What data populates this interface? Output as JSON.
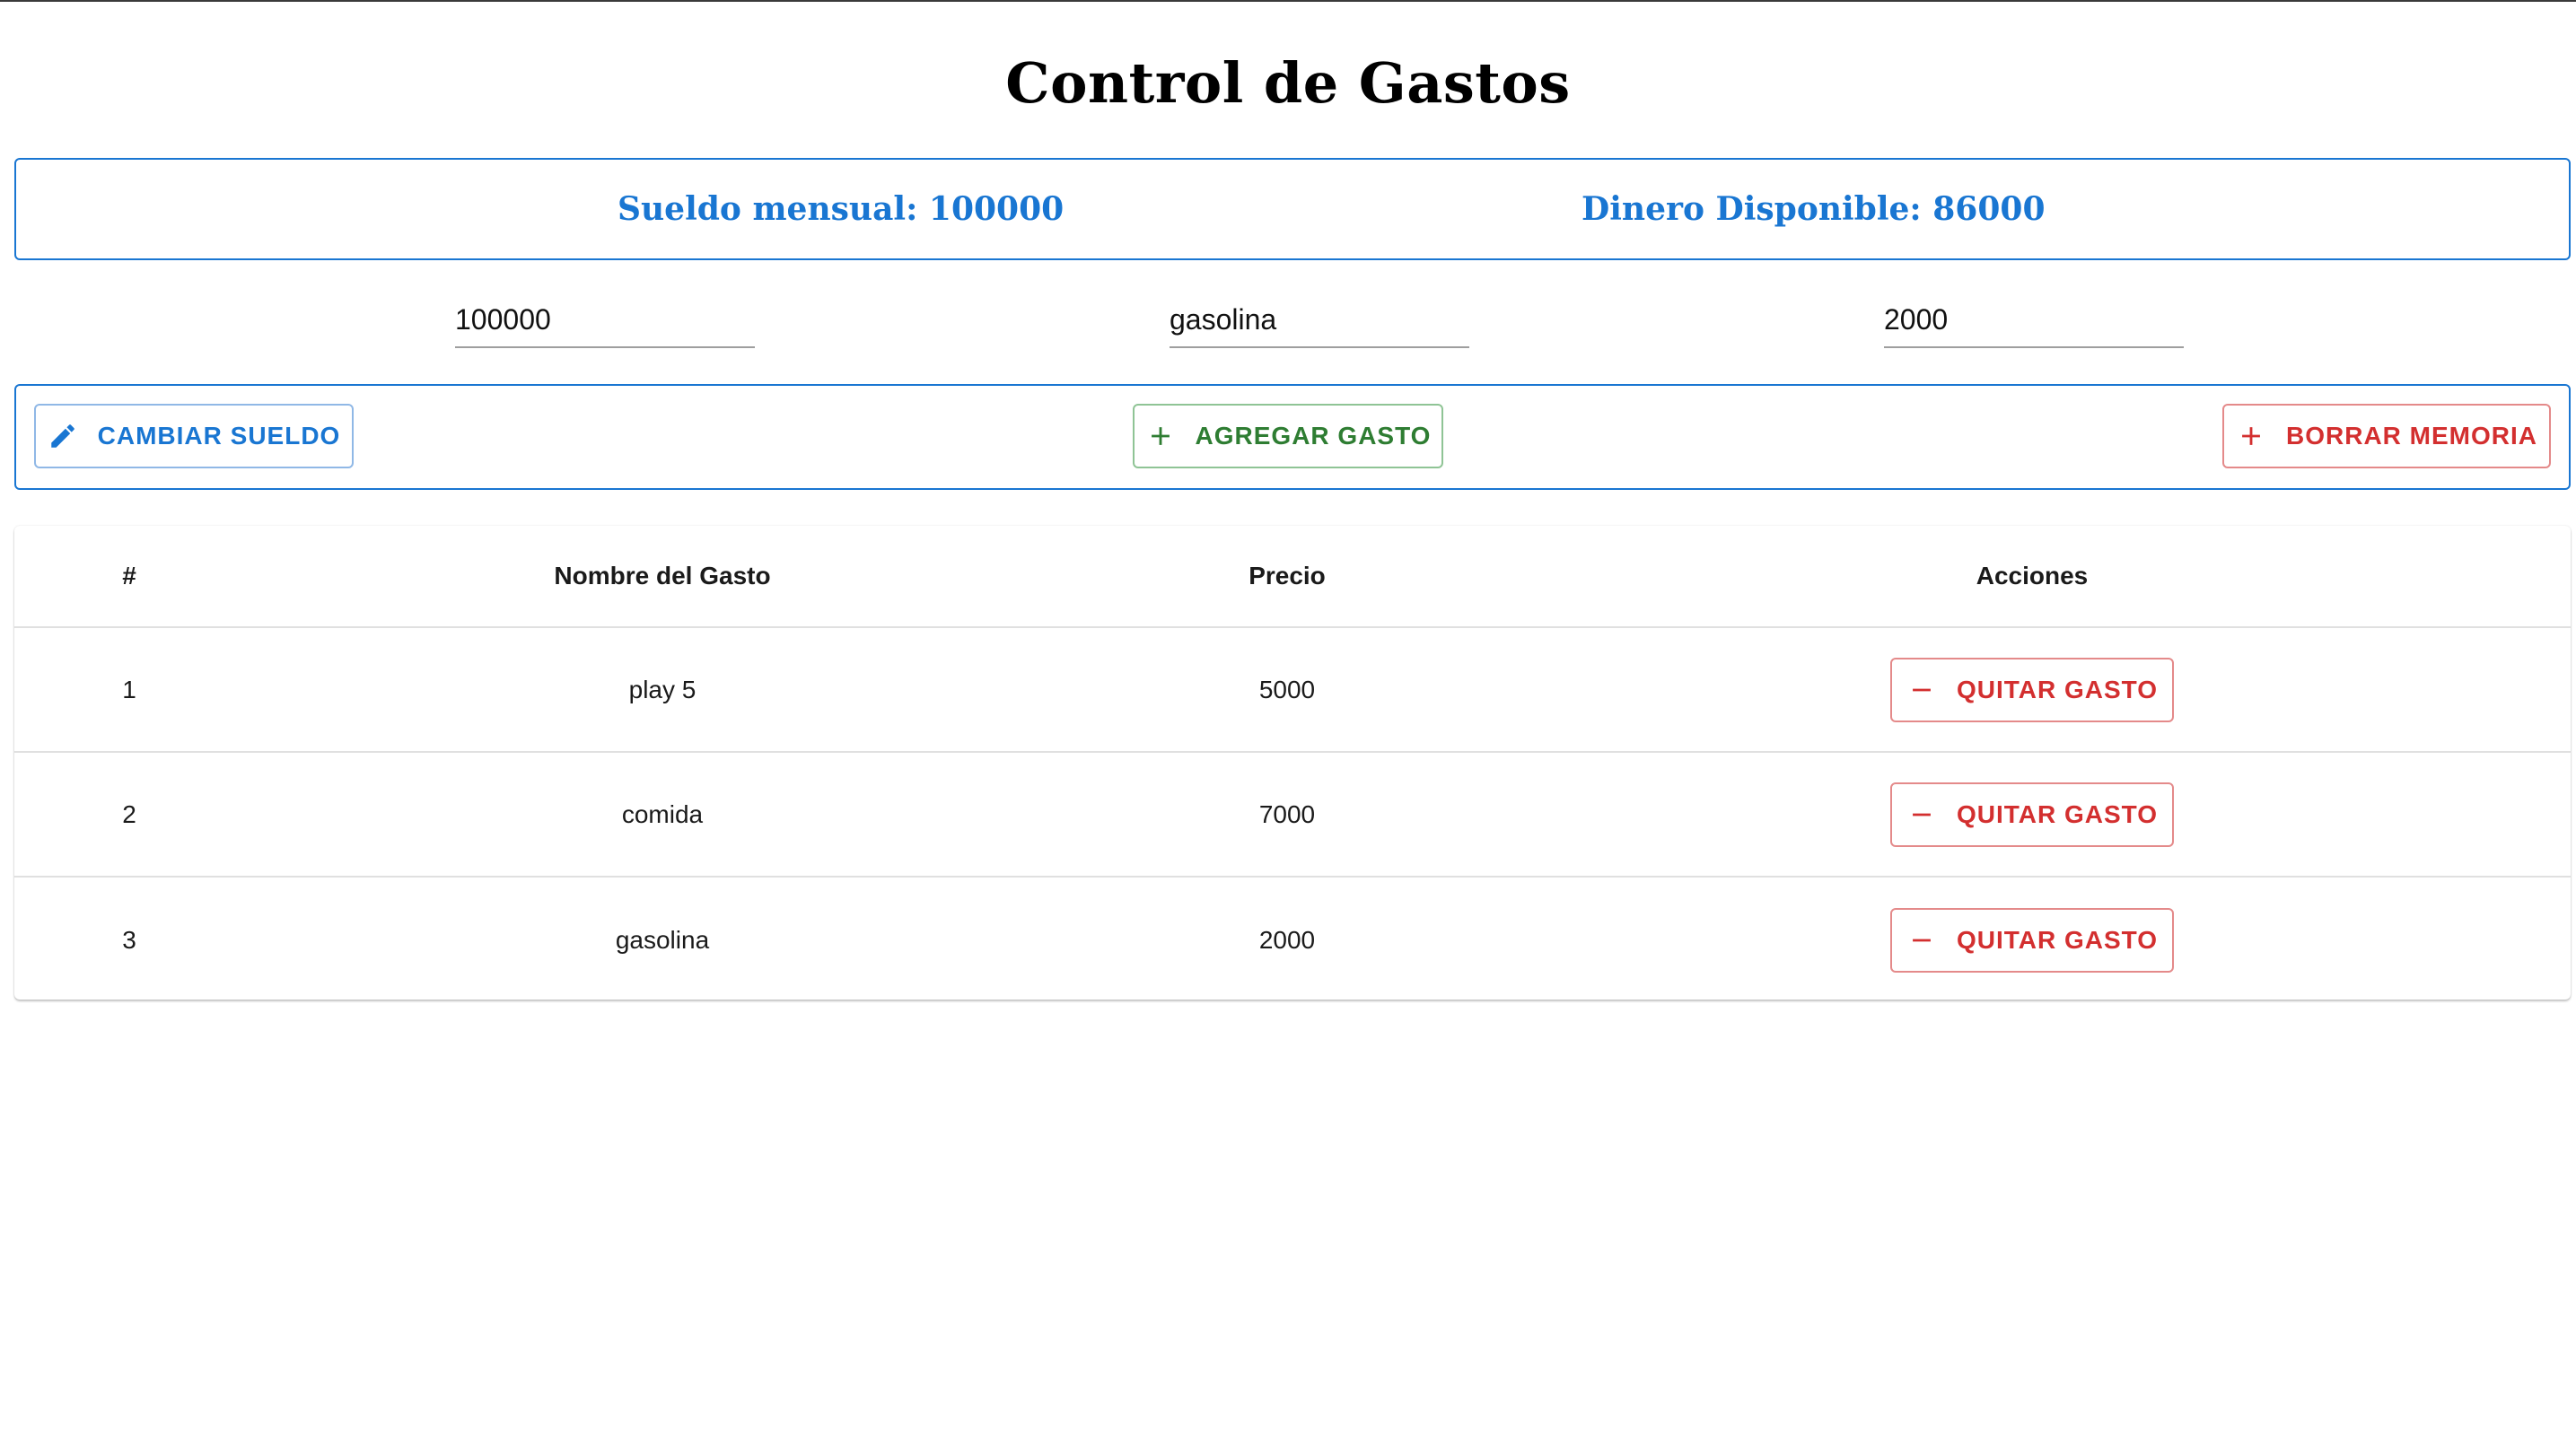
{
  "title": "Control de Gastos",
  "summary": {
    "sueldo_label": "Sueldo mensual: 100000",
    "disponible_label": "Dinero Disponible: 86000"
  },
  "inputs": {
    "sueldo_value": "100000",
    "nombre_value": "gasolina",
    "precio_value": "2000"
  },
  "actions": {
    "cambiar_label": "CAMBIAR SUELDO",
    "cambiar_icon": "pencil-icon",
    "agregar_label": "AGREGAR GASTO",
    "agregar_icon": "plus-icon",
    "borrar_label": "BORRAR MEMORIA",
    "borrar_icon": "plus-icon"
  },
  "table": {
    "headers": [
      "#",
      "Nombre del Gasto",
      "Precio",
      "Acciones"
    ],
    "rows": [
      {
        "num": "1",
        "nombre": "play 5",
        "precio": "5000",
        "action_label": "QUITAR GASTO"
      },
      {
        "num": "2",
        "nombre": "comida",
        "precio": "7000",
        "action_label": "QUITAR GASTO"
      },
      {
        "num": "3",
        "nombre": "gasolina",
        "precio": "2000",
        "action_label": "QUITAR GASTO"
      }
    ],
    "action_icon": "minus-icon"
  },
  "colors": {
    "primary": "#1976d2",
    "success": "#2e7d32",
    "error": "#d32f2f"
  }
}
